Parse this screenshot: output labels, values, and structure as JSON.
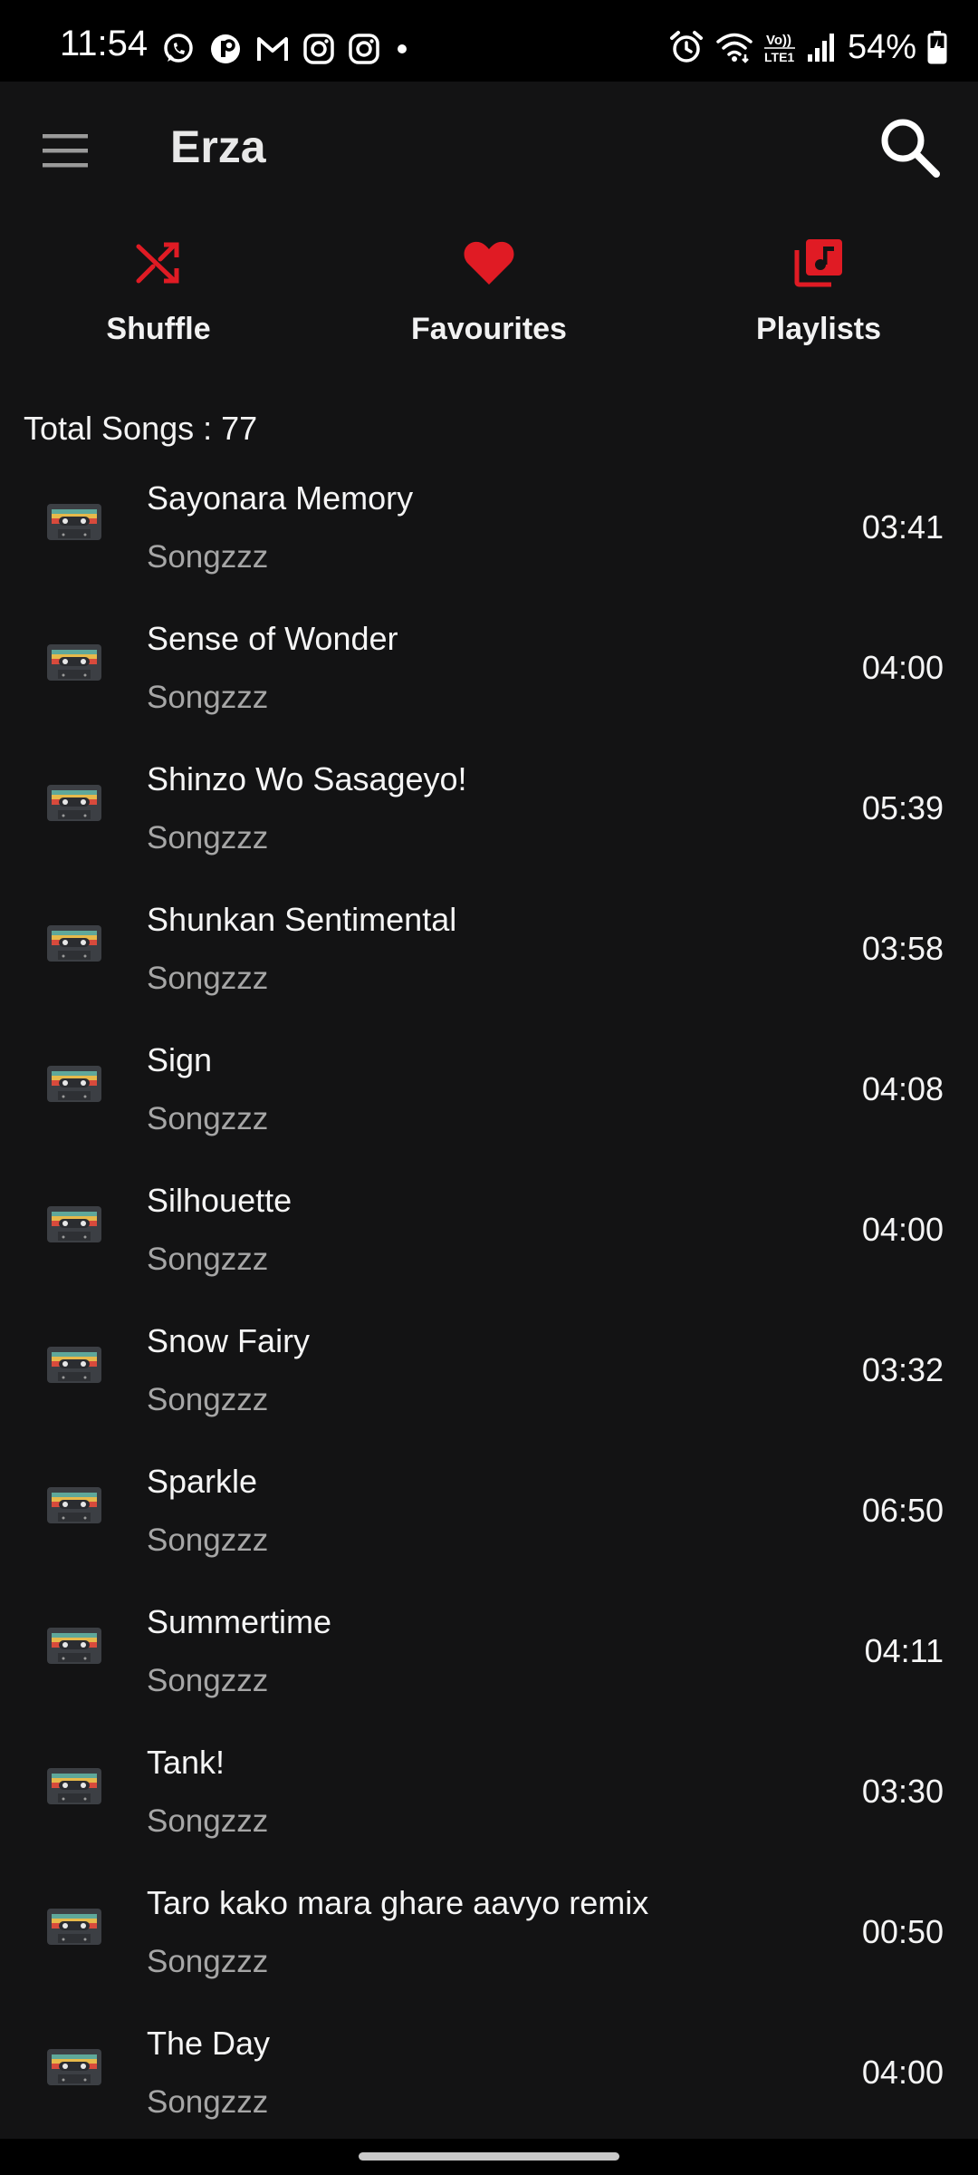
{
  "status_bar": {
    "time": "11:54",
    "battery": "54%",
    "icons": [
      "whatsapp-icon",
      "app-icon",
      "gmail-icon",
      "instagram-icon",
      "instagram-icon",
      "dot-icon",
      "alarm-icon",
      "wifi-icon",
      "volte-icon",
      "signal-icon",
      "battery-charging-icon"
    ]
  },
  "app_bar": {
    "title": "Erza",
    "menu_icon": "menu-icon",
    "search_icon": "search-icon"
  },
  "actions": [
    {
      "label": "Shuffle",
      "icon": "shuffle-icon"
    },
    {
      "label": "Favourites",
      "icon": "heart-icon"
    },
    {
      "label": "Playlists",
      "icon": "playlist-icon"
    }
  ],
  "total_songs": "Total Songs : 77",
  "songs": [
    {
      "title": "Sayonara Memory",
      "artist": "Songzzz",
      "duration": "03:41"
    },
    {
      "title": "Sense of Wonder",
      "artist": "Songzzz",
      "duration": "04:00"
    },
    {
      "title": "Shinzo Wo Sasageyo!",
      "artist": "Songzzz",
      "duration": "05:39"
    },
    {
      "title": "Shunkan Sentimental",
      "artist": "Songzzz",
      "duration": "03:58"
    },
    {
      "title": "Sign",
      "artist": "Songzzz",
      "duration": "04:08"
    },
    {
      "title": "Silhouette",
      "artist": "Songzzz",
      "duration": "04:00"
    },
    {
      "title": "Snow Fairy",
      "artist": "Songzzz",
      "duration": "03:32"
    },
    {
      "title": "Sparkle",
      "artist": "Songzzz",
      "duration": "06:50"
    },
    {
      "title": "Summertime",
      "artist": "Songzzz",
      "duration": "04:11"
    },
    {
      "title": "Tank!",
      "artist": "Songzzz",
      "duration": "03:30"
    },
    {
      "title": "Taro kako mara ghare aavyo remix",
      "artist": "Songzzz",
      "duration": "00:50"
    },
    {
      "title": "The Day",
      "artist": "Songzzz",
      "duration": "04:00"
    }
  ],
  "colors": {
    "background": "#131314",
    "accent": "#e01b24",
    "text_primary": "#f5f5f5",
    "text_secondary": "#a6a6a6"
  }
}
